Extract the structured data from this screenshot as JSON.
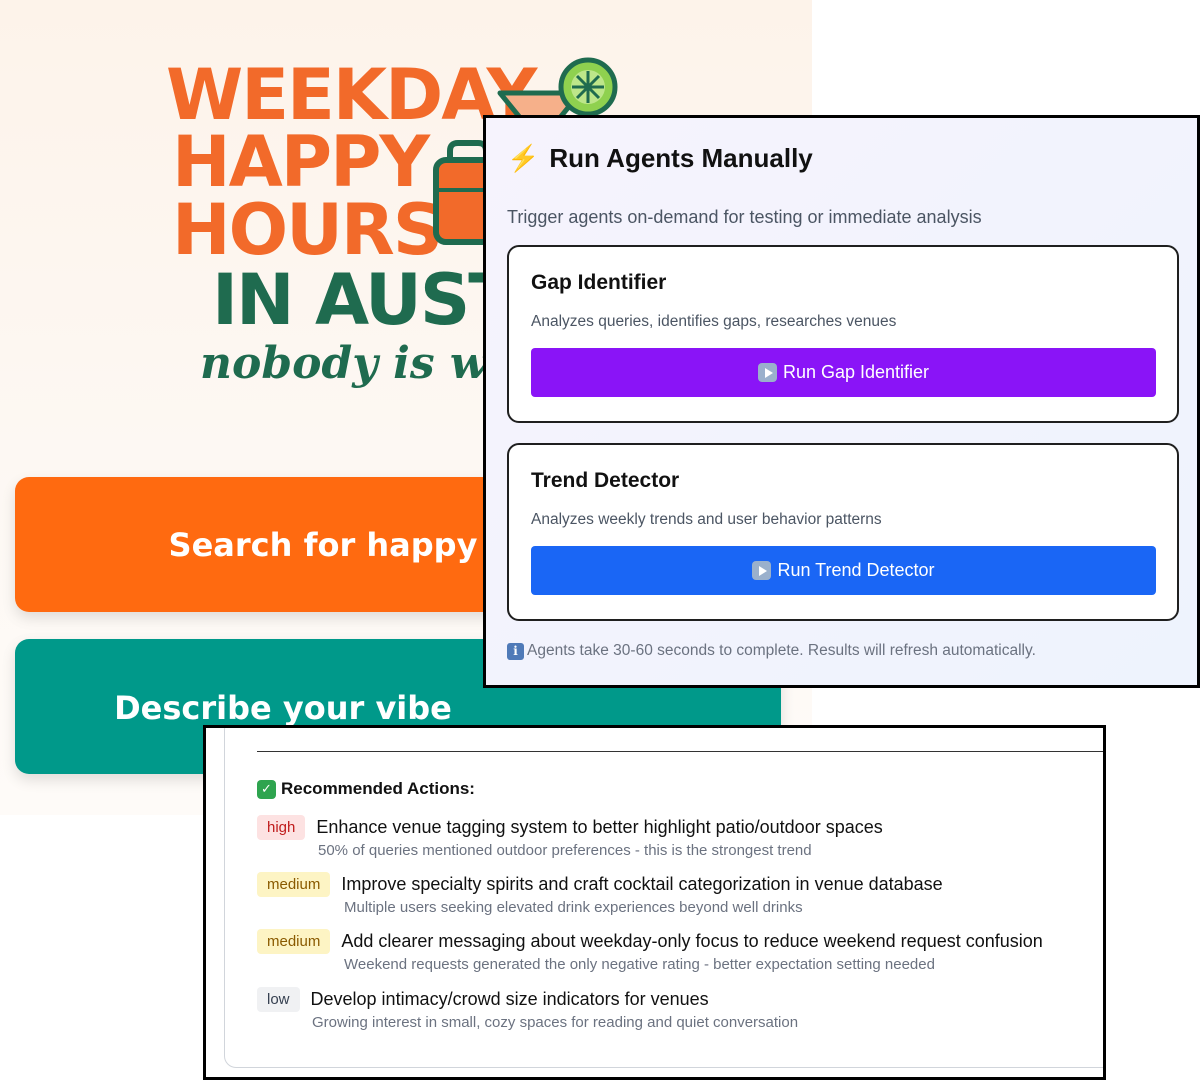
{
  "landing": {
    "logo": {
      "line1": "WEEKDAY",
      "line2": "HAPPY",
      "line3": "HOURS",
      "line4": "IN AUST",
      "tagline": "nobody is work"
    },
    "search_button": "Search for happy",
    "vibe_button": "Describe your vibe",
    "colors": {
      "orange": "#ff6a10",
      "teal": "#00998a",
      "logo_green": "#1f6b4f"
    }
  },
  "agents_panel": {
    "icon": "lightning-icon",
    "title": "Run Agents Manually",
    "subtitle": "Trigger agents on-demand for testing or immediate analysis",
    "cards": [
      {
        "title": "Gap Identifier",
        "description": "Analyzes queries, identifies gaps, researches venues",
        "button_label": "Run Gap Identifier",
        "button_color": "#8a14f7"
      },
      {
        "title": "Trend Detector",
        "description": "Analyzes weekly trends and user behavior patterns",
        "button_label": "Run Trend Detector",
        "button_color": "#1a66f5"
      }
    ],
    "note": "Agents take 30-60 seconds to complete. Results will refresh automatically."
  },
  "actions_panel": {
    "heading": "Recommended Actions:",
    "items": [
      {
        "priority": "high",
        "title": "Enhance venue tagging system to better highlight patio/outdoor spaces",
        "detail": "50% of queries mentioned outdoor preferences - this is the strongest trend"
      },
      {
        "priority": "medium",
        "title": "Improve specialty spirits and craft cocktail categorization in venue database",
        "detail": "Multiple users seeking elevated drink experiences beyond well drinks"
      },
      {
        "priority": "medium",
        "title": "Add clearer messaging about weekday-only focus to reduce weekend request confusion",
        "detail": "Weekend requests generated the only negative rating - better expectation setting needed"
      },
      {
        "priority": "low",
        "title": "Develop intimacy/crowd size indicators for venues",
        "detail": "Growing interest in small, cozy spaces for reading and quiet conversation"
      }
    ]
  }
}
